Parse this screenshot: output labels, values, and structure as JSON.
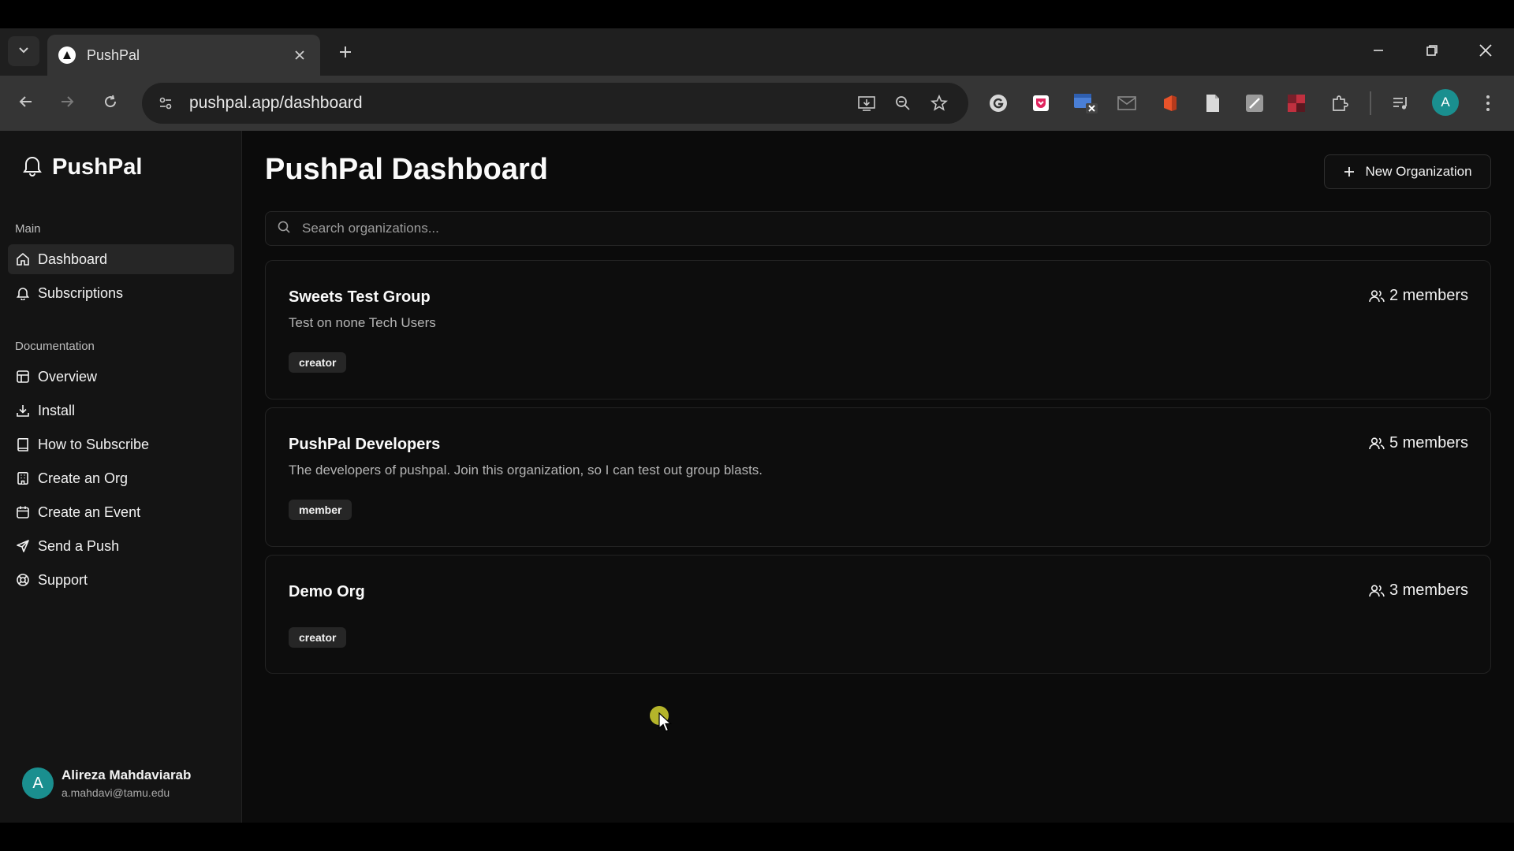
{
  "browser": {
    "tab_title": "PushPal",
    "url": "pushpal.app/dashboard",
    "profile_initial": "A",
    "extensions": [
      "grammarly-icon",
      "pocket-icon",
      "window-resizer-icon",
      "mail-icon",
      "office-icon",
      "document-icon",
      "note-icon",
      "dark-reader-icon",
      "puzzle-icon"
    ]
  },
  "sidebar": {
    "brand": "PushPal",
    "main_label": "Main",
    "main_items": [
      {
        "label": "Dashboard",
        "icon": "home-icon",
        "active": true
      },
      {
        "label": "Subscriptions",
        "icon": "bell-icon"
      }
    ],
    "docs_label": "Documentation",
    "docs_items": [
      {
        "label": "Overview",
        "icon": "layout-icon"
      },
      {
        "label": "Install",
        "icon": "download-icon"
      },
      {
        "label": "How to Subscribe",
        "icon": "book-icon"
      },
      {
        "label": "Create an Org",
        "icon": "building-icon"
      },
      {
        "label": "Create an Event",
        "icon": "calendar-icon"
      },
      {
        "label": "Send a Push",
        "icon": "send-icon"
      },
      {
        "label": "Support",
        "icon": "lifebuoy-icon"
      }
    ],
    "user": {
      "initial": "A",
      "name": "Alireza Mahdaviarab",
      "email": "a.mahdavi@tamu.edu"
    }
  },
  "main": {
    "title": "PushPal Dashboard",
    "new_org_label": "New Organization",
    "search_placeholder": "Search organizations...",
    "organizations": [
      {
        "name": "Sweets Test Group",
        "description": "Test on none Tech Users",
        "role": "creator",
        "members": "2 members"
      },
      {
        "name": "PushPal Developers",
        "description": "The developers of pushpal. Join this organization, so I can test out group blasts.",
        "role": "member",
        "members": "5 members"
      },
      {
        "name": "Demo Org",
        "description": "",
        "role": "creator",
        "members": "3 members"
      }
    ]
  },
  "colors": {
    "accent_avatar": "#1a8f8f",
    "cursor_highlight": "#b4b42a"
  }
}
